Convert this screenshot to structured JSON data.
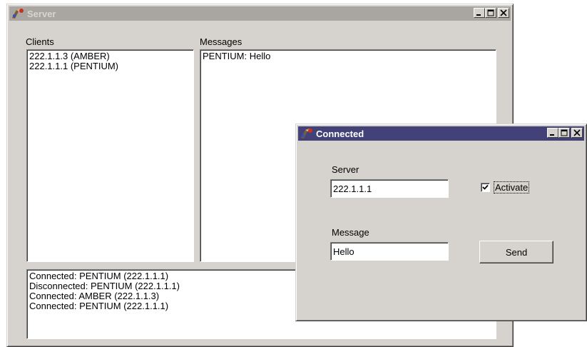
{
  "server_window": {
    "title": "Server",
    "clients_label": "Clients",
    "messages_label": "Messages",
    "clients": [
      "222.1.1.3 (AMBER)",
      "222.1.1.1 (PENTIUM)"
    ],
    "messages": [
      "PENTIUM: Hello"
    ],
    "log": [
      "Connected: PENTIUM (222.1.1.1)",
      "Disconnected: PENTIUM (222.1.1.1)",
      "Connected: AMBER (222.1.1.3)",
      "Connected: PENTIUM (222.1.1.1)"
    ]
  },
  "client_window": {
    "title": "Connected",
    "server_label": "Server",
    "server_value": "222.1.1.1",
    "activate_label": "Activate",
    "activate_checked": true,
    "message_label": "Message",
    "message_value": "Hello",
    "send_label": "Send"
  },
  "colors": {
    "inactive_title": "#a9a5a0",
    "active_title": "#424278",
    "face": "#d6d3ce"
  }
}
